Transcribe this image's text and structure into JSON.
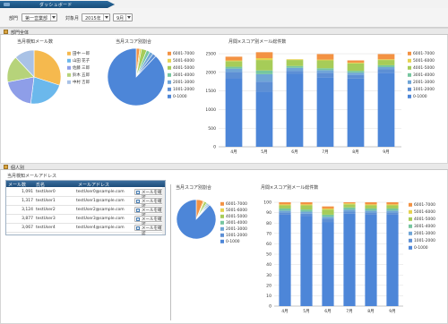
{
  "header": {
    "tab_label": "ダッシュボード"
  },
  "filters": {
    "department_label": "部門",
    "department_value": "第一営業部",
    "month_label": "対象月",
    "year_value": "2015年",
    "month_value": "9月"
  },
  "sections": {
    "department": "部門全体",
    "individual": "個人別"
  },
  "charts": {
    "dept_pie_title": "当月検知メール数",
    "dept_score_title": "当月スコア別割合",
    "dept_bar_title": "月間×スコア別メール総件数",
    "ind_section_title": "当月検知メールアドレス",
    "ind_score_title": "当月スコア別割合",
    "ind_bar_title": "月間×スコア別メール総件数"
  },
  "table": {
    "headers": [
      "メール数",
      "氏名",
      "メールアドレス"
    ],
    "rows": [
      {
        "count": "1,091",
        "name": "testUser0",
        "email": "testUser0@sample.com",
        "action": "メールを確認"
      },
      {
        "count": "1,317",
        "name": "testUser1",
        "email": "testUser1@sample.com",
        "action": "メールを確認"
      },
      {
        "count": "3,124",
        "name": "testUser2",
        "email": "testUser2@sample.com",
        "action": "メールを確認"
      },
      {
        "count": "3,877",
        "name": "testUser3",
        "email": "testUser3@sample.com",
        "action": "メールを確認"
      },
      {
        "count": "3,067",
        "name": "testUser4",
        "email": "testUser4@sample.com",
        "action": "メールを確認"
      }
    ]
  },
  "chart_data": [
    {
      "type": "pie",
      "title": "当月検知メール数",
      "labels": [
        "田中 一郎",
        "山田 花子",
        "佐藤 三郎",
        "鈴木 五郎",
        "中村 吉郎"
      ],
      "values": [
        30,
        22,
        20,
        16,
        12
      ],
      "colors": [
        "#f5b94e",
        "#6bb8ec",
        "#8e9ee8",
        "#b6d37a",
        "#a9c2e6"
      ]
    },
    {
      "type": "pie",
      "title": "当月スコア別割合",
      "labels": [
        "6001-7000",
        "5001-6000",
        "4001-5000",
        "3001-4000",
        "2001-3000",
        "1001-2000",
        "0-1000"
      ],
      "values": [
        2,
        1,
        3,
        2,
        2,
        2,
        88
      ],
      "colors": [
        "#f39243",
        "#e6d24f",
        "#a6cc58",
        "#76c6a0",
        "#6fa5d6",
        "#5d8fd4",
        "#4d86d8"
      ]
    },
    {
      "type": "bar",
      "title": "月間×スコア別メール総件数",
      "categories": [
        "4月",
        "5月",
        "6月",
        "7月",
        "8月",
        "9月"
      ],
      "ylim": [
        0,
        2500
      ],
      "yticks": [
        0,
        500,
        1000,
        1500,
        2000,
        2500
      ],
      "series": [
        {
          "name": "0-1000",
          "values": [
            1840,
            1480,
            1960,
            1860,
            1830,
            1990
          ]
        },
        {
          "name": "1001-2000",
          "values": [
            170,
            270,
            80,
            130,
            100,
            90
          ]
        },
        {
          "name": "2001-3000",
          "values": [
            90,
            200,
            80,
            70,
            60,
            60
          ]
        },
        {
          "name": "3001-4000",
          "values": [
            50,
            100,
            50,
            50,
            50,
            50
          ]
        },
        {
          "name": "4001-5000",
          "values": [
            150,
            280,
            160,
            210,
            200,
            140
          ]
        },
        {
          "name": "5001-6000",
          "values": [
            20,
            50,
            20,
            20,
            20,
            20
          ]
        },
        {
          "name": "6001-7000",
          "values": [
            100,
            160,
            0,
            150,
            60,
            140
          ]
        }
      ],
      "colors": [
        "#4d86d8",
        "#5d8fd4",
        "#6fa5d6",
        "#76c6a0",
        "#a6cc58",
        "#e6d24f",
        "#f39243"
      ]
    },
    {
      "type": "pie",
      "title": "当月スコア別割合",
      "labels": [
        "6001-7000",
        "5001-6000",
        "4001-5000",
        "3001-4000",
        "2001-3000",
        "1001-2000",
        "0-1000"
      ],
      "values": [
        6,
        1,
        2,
        1,
        1,
        1,
        88
      ],
      "colors": [
        "#f39243",
        "#e6d24f",
        "#a6cc58",
        "#76c6a0",
        "#6fa5d6",
        "#5d8fd4",
        "#4d86d8"
      ]
    },
    {
      "type": "bar",
      "title": "月間×スコア別メール総件数",
      "categories": [
        "4月",
        "5月",
        "6月",
        "7月",
        "8月",
        "9月"
      ],
      "ylim": [
        0,
        100
      ],
      "yticks": [
        0,
        10,
        20,
        30,
        40,
        50,
        60,
        70,
        80,
        90,
        100
      ],
      "series": [
        {
          "name": "0-1000",
          "values": [
            88,
            87,
            81,
            89,
            88,
            88
          ]
        },
        {
          "name": "1001-2000",
          "values": [
            2,
            2,
            3,
            2,
            2,
            2
          ]
        },
        {
          "name": "2001-3000",
          "values": [
            2,
            2,
            2,
            2,
            2,
            2
          ]
        },
        {
          "name": "3001-4000",
          "values": [
            2,
            2,
            2,
            2,
            2,
            2
          ]
        },
        {
          "name": "4001-5000",
          "values": [
            3,
            4,
            5,
            3,
            3,
            3
          ]
        },
        {
          "name": "5001-6000",
          "values": [
            1,
            1,
            1,
            1,
            1,
            1
          ]
        },
        {
          "name": "6001-7000",
          "values": [
            2,
            2,
            2,
            1,
            2,
            2
          ]
        }
      ],
      "colors": [
        "#4d86d8",
        "#5d8fd4",
        "#6fa5d6",
        "#76c6a0",
        "#a6cc58",
        "#e6d24f",
        "#f39243"
      ]
    }
  ]
}
